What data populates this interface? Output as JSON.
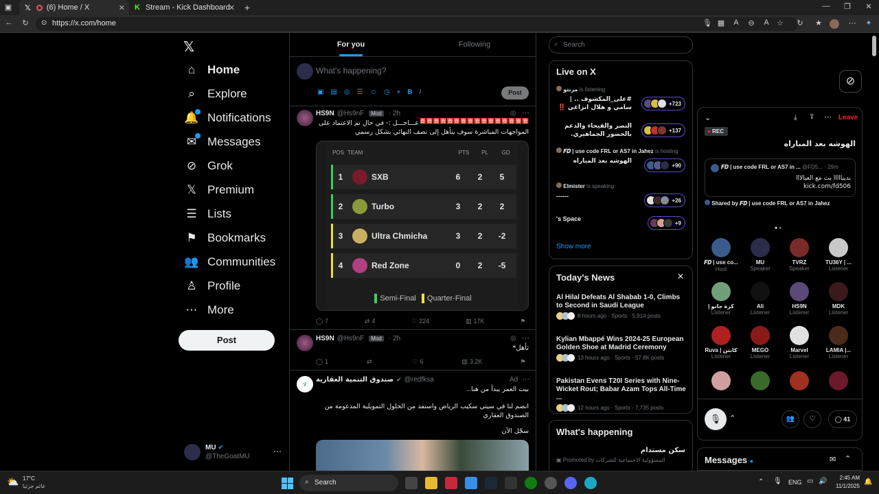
{
  "browser": {
    "tabs": [
      {
        "label": "(6) Home / X",
        "active": true
      },
      {
        "label": "Stream - Kick Dashboard",
        "active": false
      }
    ],
    "new_tab": "+",
    "url": "https://x.com/home",
    "window_controls": [
      "minimize",
      "maximize",
      "close"
    ]
  },
  "nav": {
    "items": [
      {
        "label": "Home",
        "icon": "home-icon"
      },
      {
        "label": "Explore",
        "icon": "search-icon"
      },
      {
        "label": "Notifications",
        "icon": "bell-icon"
      },
      {
        "label": "Messages",
        "icon": "mail-icon"
      },
      {
        "label": "Grok",
        "icon": "grok-icon"
      },
      {
        "label": "Premium",
        "icon": "x-icon"
      },
      {
        "label": "Lists",
        "icon": "list-icon"
      },
      {
        "label": "Bookmarks",
        "icon": "bookmark-icon"
      },
      {
        "label": "Communities",
        "icon": "people-icon"
      },
      {
        "label": "Profile",
        "icon": "user-icon"
      },
      {
        "label": "More",
        "icon": "more-circle-icon"
      }
    ],
    "post_button": "Post",
    "account": {
      "name": "MU",
      "handle": "@TheGoatMU"
    }
  },
  "timeline": {
    "tabs": [
      "For you",
      "Following"
    ],
    "compose": {
      "placeholder": "What's happening?",
      "post_button": "Post"
    },
    "post1": {
      "name": "HS9N",
      "handle": "@Hs9nF",
      "badge": "Mod",
      "time": "2h",
      "text_line1": "عـــاجـــل :- في حال تم الاعتماد على",
      "text_line2": "المواجهات المباشرة سوف يتأهل إلى نصف النهائي بشكل رسمي",
      "emoji_row": "🈴🈴🈴🈴🈴🈴🈴🈴🈴🈴🈴🈴🈴🈴🈴🈴🈴",
      "table": {
        "headers": [
          "POS",
          "TEAM",
          "PTS",
          "PL",
          "GD"
        ],
        "rows": [
          {
            "pos": "1",
            "team": "SXB",
            "pts": "6",
            "pl": "2",
            "gd": "5",
            "bar": "#39d353"
          },
          {
            "pos": "2",
            "team": "Turbo",
            "pts": "3",
            "pl": "2",
            "gd": "2",
            "bar": "#39d353"
          },
          {
            "pos": "3",
            "team": "Ultra Chmicha",
            "pts": "3",
            "pl": "2",
            "gd": "-2",
            "bar": "#f0e040"
          },
          {
            "pos": "4",
            "team": "Red Zone",
            "pts": "0",
            "pl": "2",
            "gd": "-5",
            "bar": "#f0e040"
          }
        ],
        "legend": [
          {
            "label": "Semi-Final",
            "color": "#39d353"
          },
          {
            "label": "Quarter-Final",
            "color": "#f0e040"
          }
        ]
      },
      "actions": {
        "replies": "7",
        "reposts": "4",
        "likes": "224",
        "views": "17K"
      }
    },
    "post2": {
      "name": "HS9N",
      "handle": "@Hs9nF",
      "badge": "Mod",
      "time": "2h",
      "text": "تأهل*",
      "actions": {
        "replies": "1",
        "reposts": "",
        "likes": "6",
        "views": "3.2K"
      }
    },
    "ad": {
      "name": "صندوق التنمية العقارية",
      "handle": "@redfksa",
      "label": "Ad",
      "line1": "بيت العمر يبدأ من هنا..",
      "line2": "انضم لنا في سيتي سكيب الرياض واستفد من الحلول التمويلية المدعومة من الصندوق العقاري",
      "line3": "سجّل الآن"
    }
  },
  "right": {
    "search_placeholder": "Search",
    "live": {
      "title": "Live on X",
      "items": [
        {
          "host": "مزنتو",
          "status": "is listening",
          "title": "#على_المكشوف .. | سامي و هلال انزاغي ‼️",
          "count": "+723"
        },
        {
          "host": "",
          "status": "",
          "title": "النصر والفيحاء والدعم بالحضور الجماهيري.",
          "count": "+137"
        },
        {
          "host": "𝑭𝑫 | use code FRL or AS7 in Jahez",
          "status": "is hosting",
          "title": "الهوشه بعد المباراه",
          "count": "+90"
        },
        {
          "host": "Elmister",
          "status": "is speaking",
          "title": "------",
          "count": "+26"
        },
        {
          "host": "",
          "status": "",
          "title": "'s Space",
          "count": "+9"
        }
      ],
      "show_more": "Show more"
    },
    "news": {
      "title": "Today's News",
      "items": [
        {
          "title": "Al Hilal Defeats Al Shabab 1-0, Climbs to Second in Saudi League",
          "meta": "8 hours ago · Sports · 5,914 posts"
        },
        {
          "title": "Kylian Mbappé Wins 2024-25 European Golden Shoe at Madrid Ceremony",
          "meta": "13 hours ago · Sports · 57.8K posts"
        },
        {
          "title": "Pakistan Evens T20I Series with Nine-Wicket Rout; Babar Azam Tops All-Time ...",
          "meta": "12 hours ago · Sports · 7,735 posts"
        }
      ]
    },
    "happening": {
      "title": "What's happening",
      "item": "سكن مستدام",
      "promo": "Promoted by المسؤولية الاجتماعية للشركات"
    }
  },
  "space": {
    "leave": "Leave",
    "rec": "REC",
    "title": "الهوشه بعد المباراه",
    "pinned": {
      "name": "𝑭𝑫 | use code FRL or AS7 in ...",
      "handle": "@FD5...",
      "time": "29m",
      "text": "بدينااااا بث مع العيالااا",
      "link": "kick.com/fd506"
    },
    "shared_by": "Shared by 𝑭𝑫 | use code FRL or AS7 in Jahez",
    "participants": [
      {
        "name": "𝑭𝑫 | use co...",
        "role": "Host",
        "color": "#3b5b8c"
      },
      {
        "name": "MU",
        "role": "Speaker",
        "color": "#2b2d4a"
      },
      {
        "name": "TVRZ",
        "role": "Speaker",
        "color": "#7a2a2a"
      },
      {
        "name": "TU36Y | ...",
        "role": "Listener",
        "color": "#c9c9c9"
      },
      {
        "name": "| كرة جانو",
        "role": "Listener",
        "color": "#6fa07a"
      },
      {
        "name": "Ali",
        "role": "Listener",
        "color": "#111111"
      },
      {
        "name": "HS9N",
        "role": "Listener",
        "color": "#5a4a7a"
      },
      {
        "name": "MDK",
        "role": "Listener",
        "color": "#3a1a1a"
      },
      {
        "name": "Ruva | كابتن",
        "role": "Listener",
        "color": "#b02020"
      },
      {
        "name": "MEGO",
        "role": "Listener",
        "color": "#8a1a1a"
      },
      {
        "name": "Marvel",
        "role": "Listener",
        "color": "#e0e0e0"
      },
      {
        "name": "LAMIA |...",
        "role": "Listener",
        "color": "#4a2a1a"
      },
      {
        "name": "",
        "role": "",
        "color": "#d0a0a0"
      },
      {
        "name": "",
        "role": "",
        "color": "#3a6a2a"
      },
      {
        "name": "",
        "role": "",
        "color": "#a03020"
      },
      {
        "name": "",
        "role": "",
        "color": "#6a1a2a"
      }
    ],
    "reply_count": "41",
    "messages": "Messages"
  },
  "taskbar": {
    "weather_temp": "17°C",
    "weather_desc": "غائم جزئيا",
    "search": "Search",
    "lang": "ENG",
    "time": "2:45 AM",
    "date": "11/1/2025"
  }
}
